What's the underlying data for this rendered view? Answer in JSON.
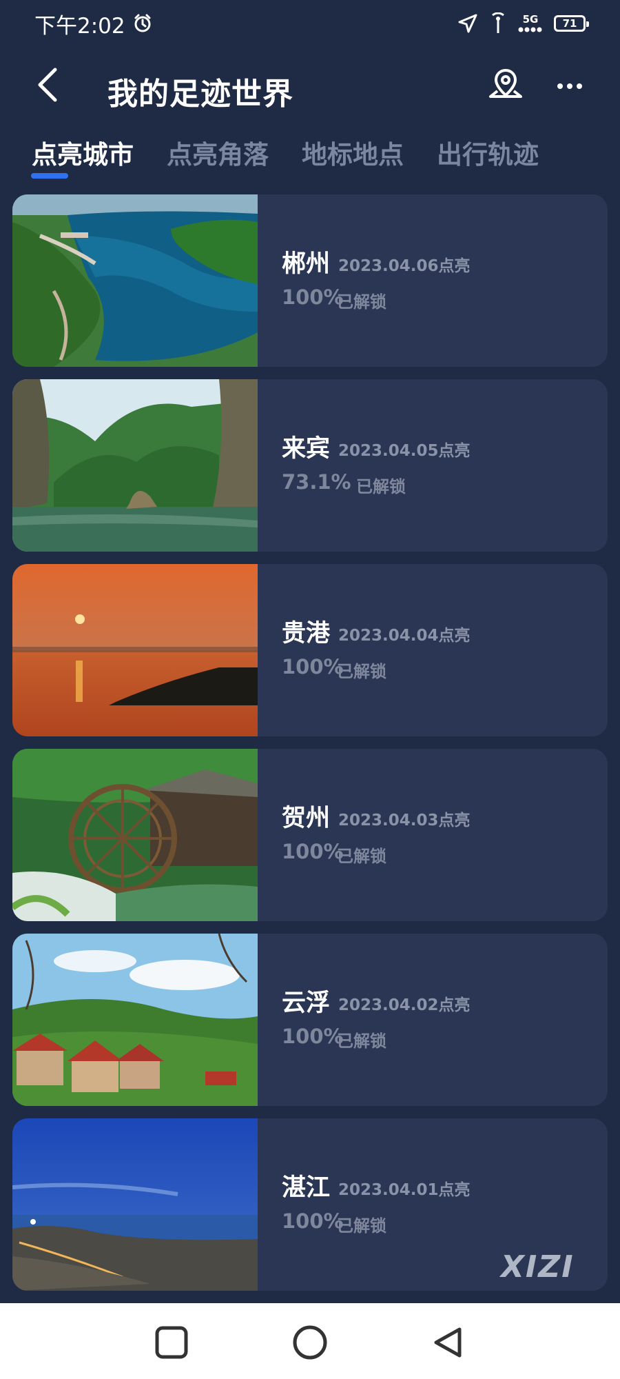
{
  "status_bar": {
    "time": "下午2:02",
    "icons": [
      "alarm-icon",
      "location-arrow-icon",
      "signal-icon",
      "network-5g-icon",
      "battery-icon"
    ],
    "network_label": "5G",
    "battery_level": "71"
  },
  "header": {
    "title": "我的足迹世界",
    "back_icon": "chevron-left-icon",
    "map_icon": "map-pin-icon",
    "more_icon": "more-dots-icon"
  },
  "tabs": [
    {
      "label": "点亮城市",
      "active": true
    },
    {
      "label": "点亮角落",
      "active": false
    },
    {
      "label": "地标地点",
      "active": false
    },
    {
      "label": "出行轨迹",
      "active": false
    }
  ],
  "cities": [
    {
      "name": "郴州",
      "date": "2023.04.06点亮",
      "progress": "100%",
      "unlock": "已解锁",
      "scene": "lake-mountains"
    },
    {
      "name": "来宾",
      "date": "2023.04.05点亮",
      "progress": "73.1%",
      "unlock": "已解锁",
      "scene": "river-cliffs"
    },
    {
      "name": "贵港",
      "date": "2023.04.04点亮",
      "progress": "100%",
      "unlock": "已解锁",
      "scene": "sunset-lake"
    },
    {
      "name": "贺州",
      "date": "2023.04.03点亮",
      "progress": "100%",
      "unlock": "已解锁",
      "scene": "waterwheel"
    },
    {
      "name": "云浮",
      "date": "2023.04.02点亮",
      "progress": "100%",
      "unlock": "已解锁",
      "scene": "village-houses"
    },
    {
      "name": "湛江",
      "date": "2023.04.01点亮",
      "progress": "100%",
      "unlock": "已解锁",
      "scene": "coast-dusk"
    }
  ],
  "watermark": "XIZI",
  "colors": {
    "background": "#1f2a44",
    "card": "#2a3653",
    "accent": "#2f72f0",
    "muted_text": "#8a93a8"
  },
  "navbar": {
    "icons": [
      "square-recent-icon",
      "circle-home-icon",
      "triangle-back-icon"
    ]
  }
}
